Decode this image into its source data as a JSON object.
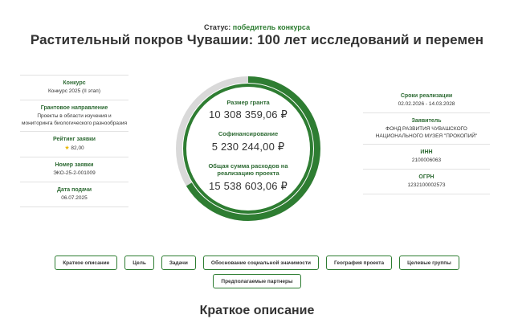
{
  "status": {
    "label": "Статус:",
    "value": "победитель конкурса"
  },
  "title": "Растительный покров Чувашии: 100 лет исследований и перемен",
  "left_info": [
    {
      "label": "Конкурс",
      "value": "Конкурс 2025 (II этап)"
    },
    {
      "label": "Грантовое направление",
      "value": "Проекты в области изучения и мониторинга биологического разнообразия"
    },
    {
      "label": "Рейтинг заявки",
      "value": "82,00"
    },
    {
      "label": "Номер заявки",
      "value": "ЭКО-25-2-001009"
    },
    {
      "label": "Дата подачи",
      "value": "06.07.2025"
    }
  ],
  "finance": {
    "grant": {
      "label": "Размер гранта",
      "value": "10 308 359,06 ₽"
    },
    "cofinancing": {
      "label": "Софинансирование",
      "value": "5 230 244,00 ₽"
    },
    "total": {
      "label": "Общая сумма расходов на реализацию проекта",
      "value": "15 538 603,06 ₽"
    },
    "grant_share": 0.6634
  },
  "right_info": [
    {
      "label": "Сроки реализации",
      "value": "02.02.2026 - 14.03.2028"
    },
    {
      "label": "Заявитель",
      "value": "ФОНД РАЗВИТИЯ ЧУВАШСКОГО НАЦИОНАЛЬНОГО МУЗЕЯ \"ПРОКОПИЙ\""
    },
    {
      "label": "ИНН",
      "value": "2100006063"
    },
    {
      "label": "ОГРН",
      "value": "1232100002573"
    }
  ],
  "tabs": [
    "Краткое описание",
    "Цель",
    "Задачи",
    "Обоснование социальной значимости",
    "География проекта",
    "Целевые группы",
    "Предполагаемые партнеры"
  ],
  "section_heading": "Краткое описание",
  "colors": {
    "accent": "#2e7d32",
    "ring_light": "#d9d9d9",
    "label_green": "#2e6b34",
    "star": "#e9b600"
  }
}
